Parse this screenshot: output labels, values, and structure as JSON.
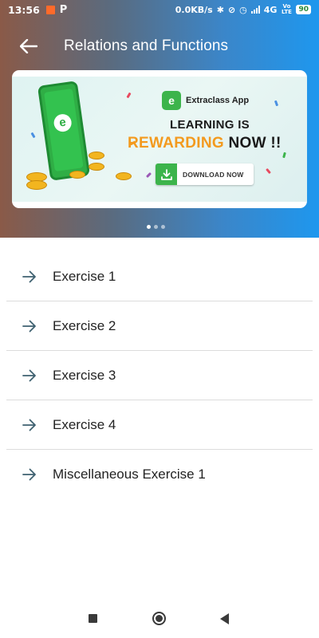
{
  "status_bar": {
    "time": "13:56",
    "notif_p": "P",
    "speed": "0.0KB/s",
    "network": "4G",
    "volte": "Vo LTE",
    "battery": "90"
  },
  "toolbar": {
    "title": "Relations and Functions"
  },
  "banner": {
    "brand_name": "Extraclass App",
    "headline_line1": "LEARNING IS",
    "headline_highlight": "REWARDING",
    "headline_rest": "NOW !!",
    "download_label": "DOWNLOAD NOW",
    "pager_count": 3,
    "pager_active": 0
  },
  "exercises": [
    {
      "label": "Exercise 1"
    },
    {
      "label": "Exercise 2"
    },
    {
      "label": "Exercise 3"
    },
    {
      "label": "Exercise 4"
    },
    {
      "label": "Miscellaneous Exercise 1"
    }
  ],
  "colors": {
    "accent_blue": "#1e97ee",
    "brand_green": "#3cb44b",
    "highlight_orange": "#f39a1e",
    "arrow_icon": "#3f6170"
  },
  "icons": {
    "back": "arrow-left-icon",
    "item": "arrow-right-icon",
    "download": "download-icon"
  }
}
